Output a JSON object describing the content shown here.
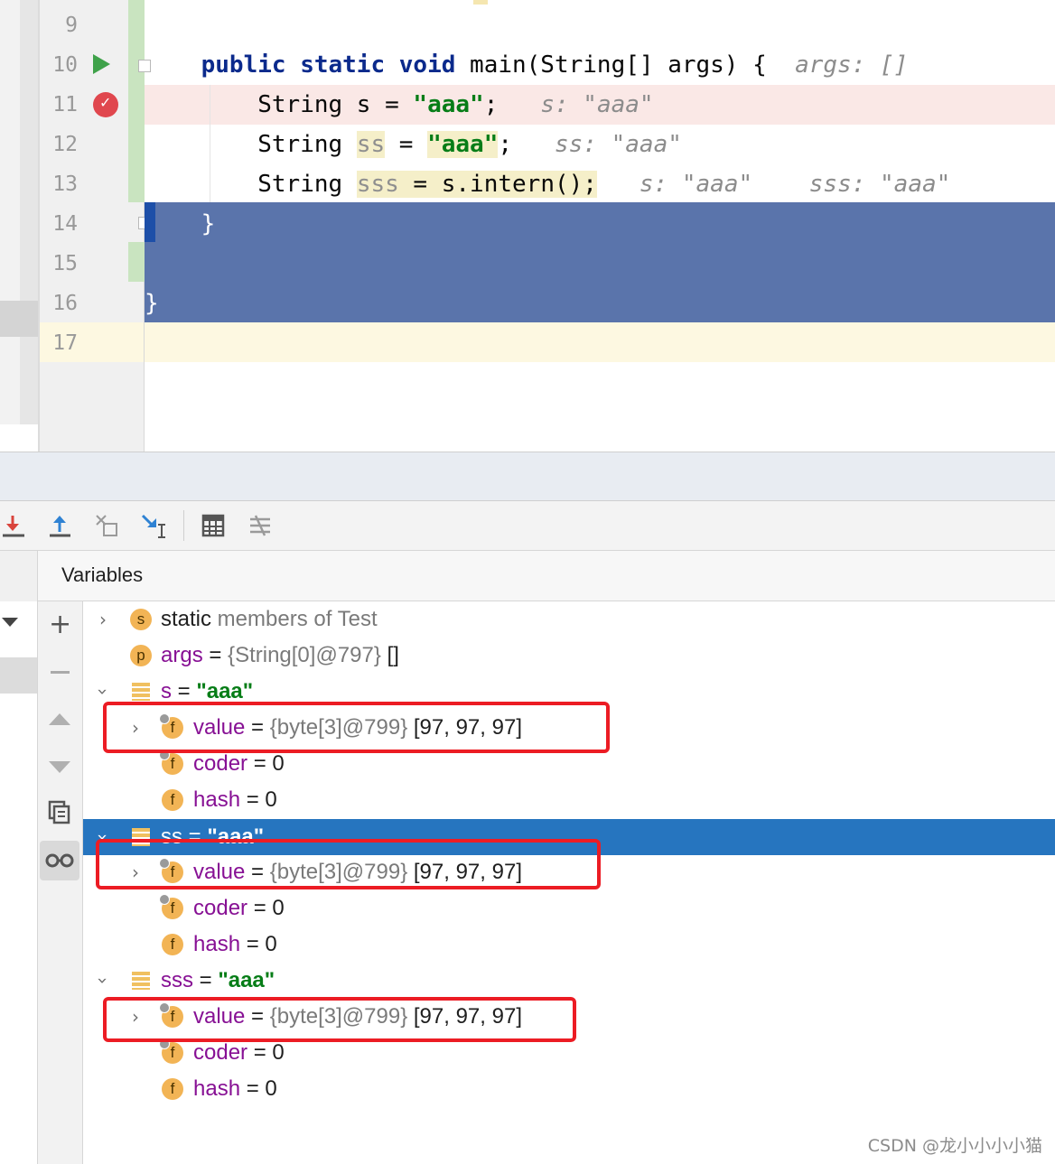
{
  "editor": {
    "line_numbers": [
      "9",
      "10",
      "11",
      "12",
      "13",
      "14",
      "15",
      "16",
      "17"
    ],
    "lines": {
      "l10": {
        "kw": "public static void",
        "rest": " main(String[] args) {",
        "hint": "args: []"
      },
      "l11": {
        "pre": "String s = ",
        "str": "\"aaa\"",
        "post": ";",
        "hint": "s: \"aaa\""
      },
      "l12": {
        "pre": "String ",
        "var": "ss",
        "mid": " = ",
        "str": "\"aaa\"",
        "post": ";",
        "hint": "ss: \"aaa\""
      },
      "l13": {
        "pre": "String ",
        "var": "sss",
        "mid": " = s.intern();",
        "hint1": "s: \"aaa\"",
        "hint2": "sss: \"aaa\""
      },
      "l14": "}",
      "l16": "}"
    }
  },
  "toolbar": {
    "icons": [
      "step-into-icon",
      "step-out-icon",
      "drop-frame-icon",
      "run-to-cursor-icon",
      "evaluate-expression-icon",
      "trace-stream-icon"
    ]
  },
  "variables": {
    "title": "Variables",
    "rows": [
      {
        "badge": "s",
        "name": "static members of Test"
      },
      {
        "badge": "p",
        "name": "args",
        "eq": " = ",
        "ref": "{String[0]@797}",
        "val": " []"
      },
      {
        "name": "s",
        "eq": " = ",
        "str": "\"aaa\""
      },
      {
        "badge": "f",
        "name": "value",
        "eq": " = ",
        "ref": "{byte[3]@799}",
        "val": " [97, 97, 97]"
      },
      {
        "badge": "f",
        "name": "coder",
        "eq": " = ",
        "val": "0"
      },
      {
        "badge": "f",
        "name": "hash",
        "eq": " = ",
        "val": "0"
      },
      {
        "name": "ss",
        "eq": " = ",
        "str": "\"aaa\""
      },
      {
        "badge": "f",
        "name": "value",
        "eq": " = ",
        "ref": "{byte[3]@799}",
        "val": " [97, 97, 97]"
      },
      {
        "badge": "f",
        "name": "coder",
        "eq": " = ",
        "val": "0"
      },
      {
        "badge": "f",
        "name": "hash",
        "eq": " = ",
        "val": "0"
      },
      {
        "name": "sss",
        "eq": " = ",
        "str": "\"aaa\""
      },
      {
        "badge": "f",
        "name": "value",
        "eq": " = ",
        "ref": "{byte[3]@799}",
        "val": " [97, 97, 97]"
      },
      {
        "badge": "f",
        "name": "coder",
        "eq": " = ",
        "val": "0"
      },
      {
        "badge": "f",
        "name": "hash",
        "eq": " = ",
        "val": "0"
      }
    ]
  },
  "watermark": "CSDN @龙小小小小猫",
  "colors": {
    "selection": "#2675bf",
    "highlight_box": "#ec1c24",
    "code_selection": "#5a74ab"
  }
}
